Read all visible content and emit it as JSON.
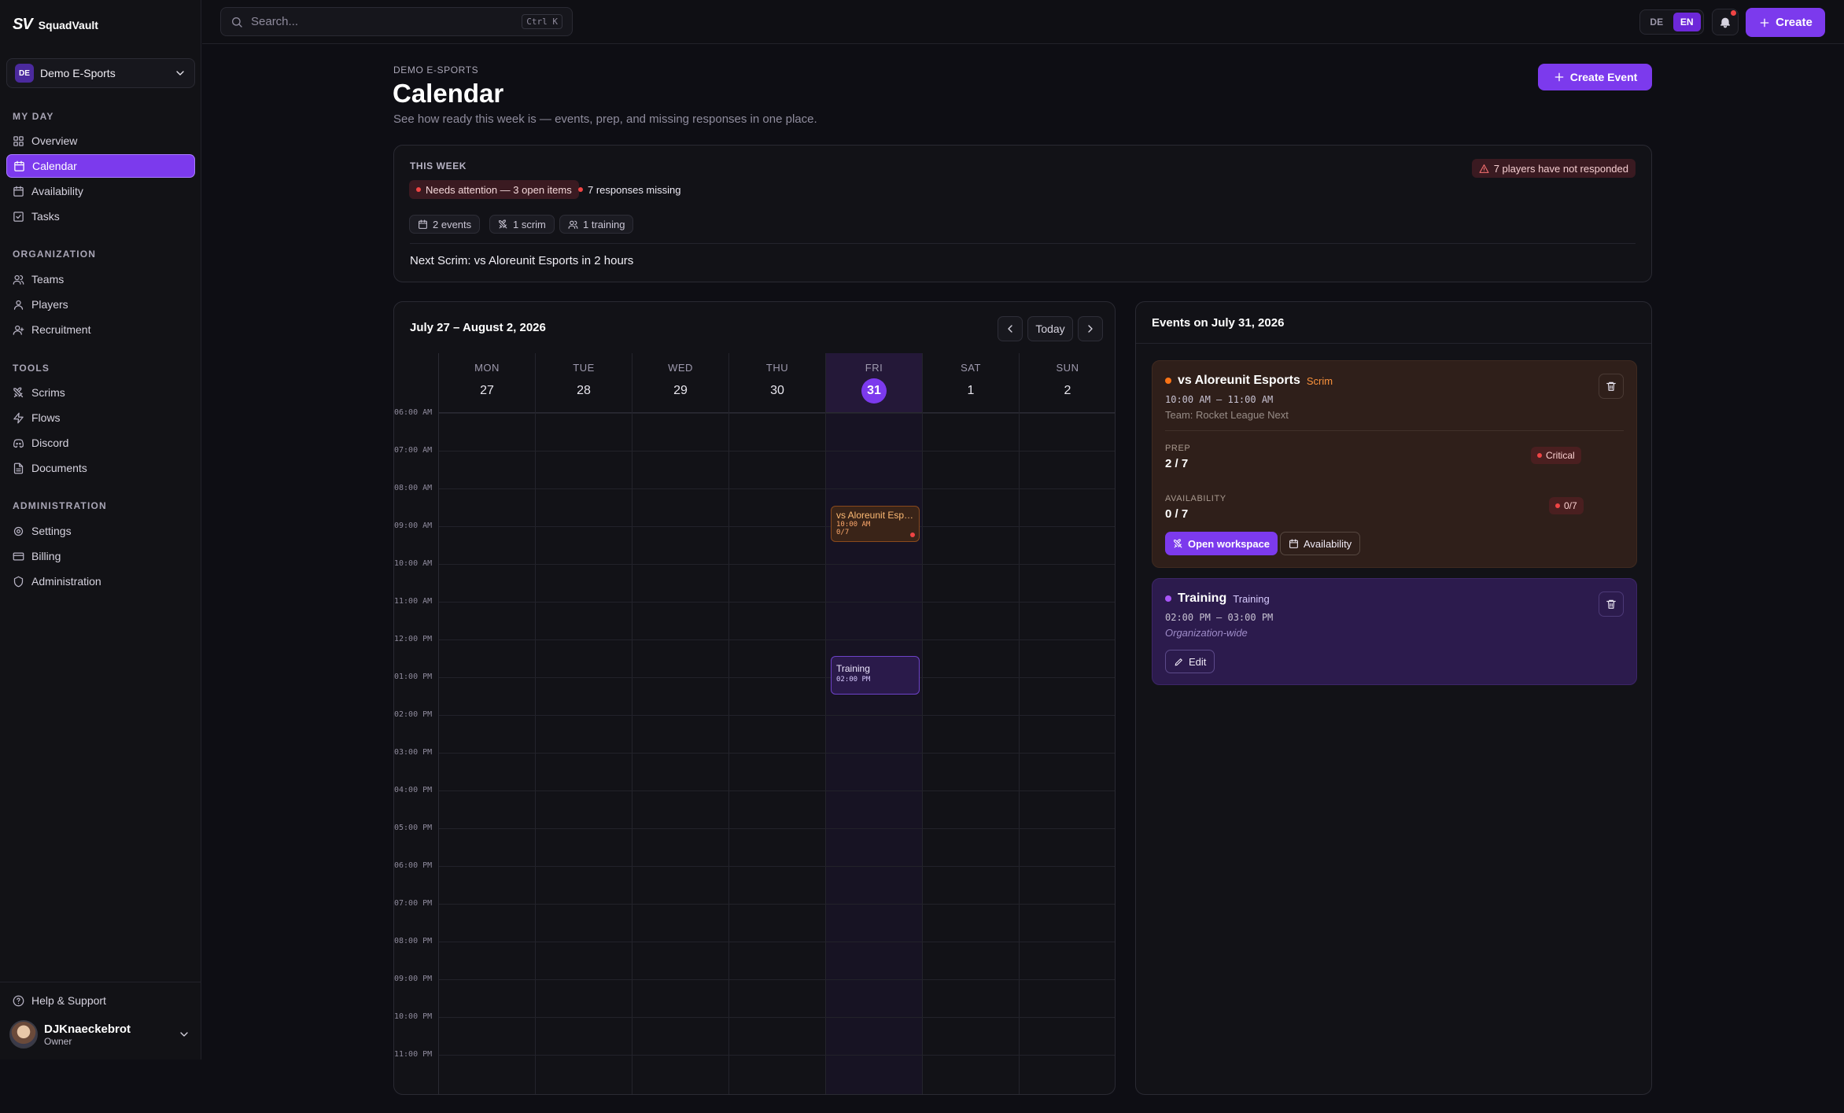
{
  "app": {
    "logo_mark": "SV",
    "logo_name": "SquadVault"
  },
  "org": {
    "badge": "DE",
    "name": "Demo E-Sports"
  },
  "sidebar": {
    "sections": [
      {
        "title": "MY DAY",
        "items": [
          {
            "label": "Overview",
            "icon": "grid-icon"
          },
          {
            "label": "Calendar",
            "icon": "calendar-icon",
            "active": true
          },
          {
            "label": "Availability",
            "icon": "calendar-icon"
          },
          {
            "label": "Tasks",
            "icon": "check-square-icon"
          }
        ]
      },
      {
        "title": "ORGANIZATION",
        "items": [
          {
            "label": "Teams",
            "icon": "users-icon"
          },
          {
            "label": "Players",
            "icon": "user-icon"
          },
          {
            "label": "Recruitment",
            "icon": "user-plus-icon"
          }
        ]
      },
      {
        "title": "TOOLS",
        "items": [
          {
            "label": "Scrims",
            "icon": "swords-icon"
          },
          {
            "label": "Flows",
            "icon": "zap-icon"
          },
          {
            "label": "Discord",
            "icon": "discord-icon"
          },
          {
            "label": "Documents",
            "icon": "file-icon"
          }
        ]
      },
      {
        "title": "ADMINISTRATION",
        "items": [
          {
            "label": "Settings",
            "icon": "gear-icon"
          },
          {
            "label": "Billing",
            "icon": "credit-card-icon"
          },
          {
            "label": "Administration",
            "icon": "shield-icon"
          }
        ]
      }
    ],
    "help": "Help & Support",
    "user": {
      "name": "DJKnaeckebrot",
      "role": "Owner"
    }
  },
  "topbar": {
    "search_placeholder": "Search...",
    "search_shortcut": "Ctrl K",
    "lang": [
      "DE",
      "EN"
    ],
    "lang_active": "EN",
    "create_label": "Create"
  },
  "page": {
    "crumb": "DEMO E-SPORTS",
    "title": "Calendar",
    "subtitle": "See how ready this week is — events, prep, and missing responses in one place.",
    "create_event_label": "Create Event"
  },
  "week": {
    "title": "THIS WEEK",
    "attention": "Needs attention — 3 open items",
    "missing": "7 responses missing",
    "players_alert": "7 players have not responded",
    "stats": [
      "2 events",
      "1 scrim",
      "1 training"
    ],
    "next": "Next Scrim: vs Aloreunit Esports in 2 hours"
  },
  "calendar": {
    "range": "July 27 – August 2, 2026",
    "today_label": "Today",
    "days": [
      {
        "name": "MON",
        "num": "27"
      },
      {
        "name": "TUE",
        "num": "28"
      },
      {
        "name": "WED",
        "num": "29"
      },
      {
        "name": "THU",
        "num": "30"
      },
      {
        "name": "FRI",
        "num": "31",
        "today": true
      },
      {
        "name": "SAT",
        "num": "1"
      },
      {
        "name": "SUN",
        "num": "2"
      }
    ],
    "hours": [
      "06:00 AM",
      "07:00 AM",
      "08:00 AM",
      "09:00 AM",
      "10:00 AM",
      "11:00 AM",
      "12:00 PM",
      "01:00 PM",
      "02:00 PM",
      "03:00 PM",
      "04:00 PM",
      "05:00 PM",
      "06:00 PM",
      "07:00 PM",
      "08:00 PM",
      "09:00 PM",
      "10:00 PM",
      "11:00 PM"
    ],
    "events": [
      {
        "title": "vs Aloreunit Espo...",
        "time": "10:00 AM",
        "status": "0/7"
      },
      {
        "title": "Training",
        "time": "02:00 PM"
      }
    ]
  },
  "events_panel": {
    "title": "Events on July 31, 2026",
    "scrim": {
      "name": "vs Aloreunit Esports",
      "type": "Scrim",
      "time": "10:00 AM – 11:00 AM",
      "team": "Team: Rocket League Next",
      "prep_label": "PREP",
      "prep_value": "2 / 7",
      "prep_status": "Critical",
      "avail_label": "AVAILABILITY",
      "avail_value": "0 / 7",
      "avail_status": "0/7",
      "btn_workspace": "Open workspace",
      "btn_availability": "Availability"
    },
    "training": {
      "name": "Training",
      "type": "Training",
      "time": "02:00 PM – 03:00 PM",
      "scope": "Organization-wide",
      "btn_edit": "Edit"
    }
  },
  "colors": {
    "accent": "#7c3aed",
    "scrim": "#f97316",
    "training": "#a855f7",
    "danger": "#ef4444"
  }
}
